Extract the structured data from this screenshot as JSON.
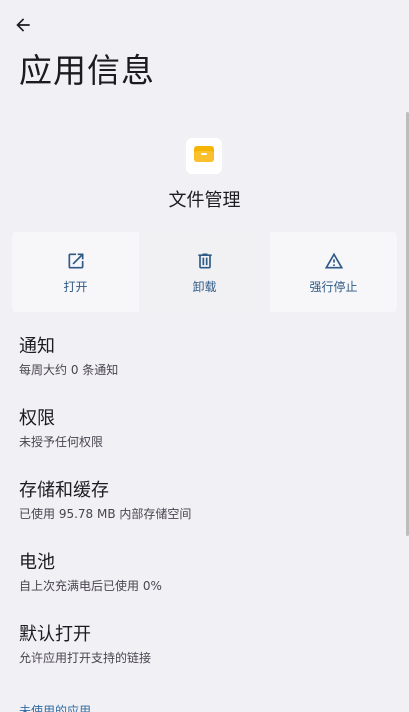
{
  "header": {
    "title": "应用信息",
    "back_icon": "arrow-left-icon"
  },
  "app": {
    "name": "文件管理",
    "icon": "folder-icon",
    "icon_color": "#f4b400"
  },
  "actions": [
    {
      "label": "打开",
      "icon": "open-external-icon"
    },
    {
      "label": "卸载",
      "icon": "trash-icon"
    },
    {
      "label": "强行停止",
      "icon": "warning-icon"
    }
  ],
  "settings": [
    {
      "title": "通知",
      "subtitle": "每周大约 0 条通知"
    },
    {
      "title": "权限",
      "subtitle": "未授予任何权限"
    },
    {
      "title": "存储和缓存",
      "subtitle": "已使用 95.78 MB 内部存储空间"
    },
    {
      "title": "电池",
      "subtitle": "自上次充满电后已使用 0%"
    },
    {
      "title": "默认打开",
      "subtitle": "允许应用打开支持的链接"
    }
  ],
  "section": {
    "label": "未使用的应用"
  },
  "colors": {
    "background": "#f1f0f5",
    "accent": "#2f5a86"
  }
}
